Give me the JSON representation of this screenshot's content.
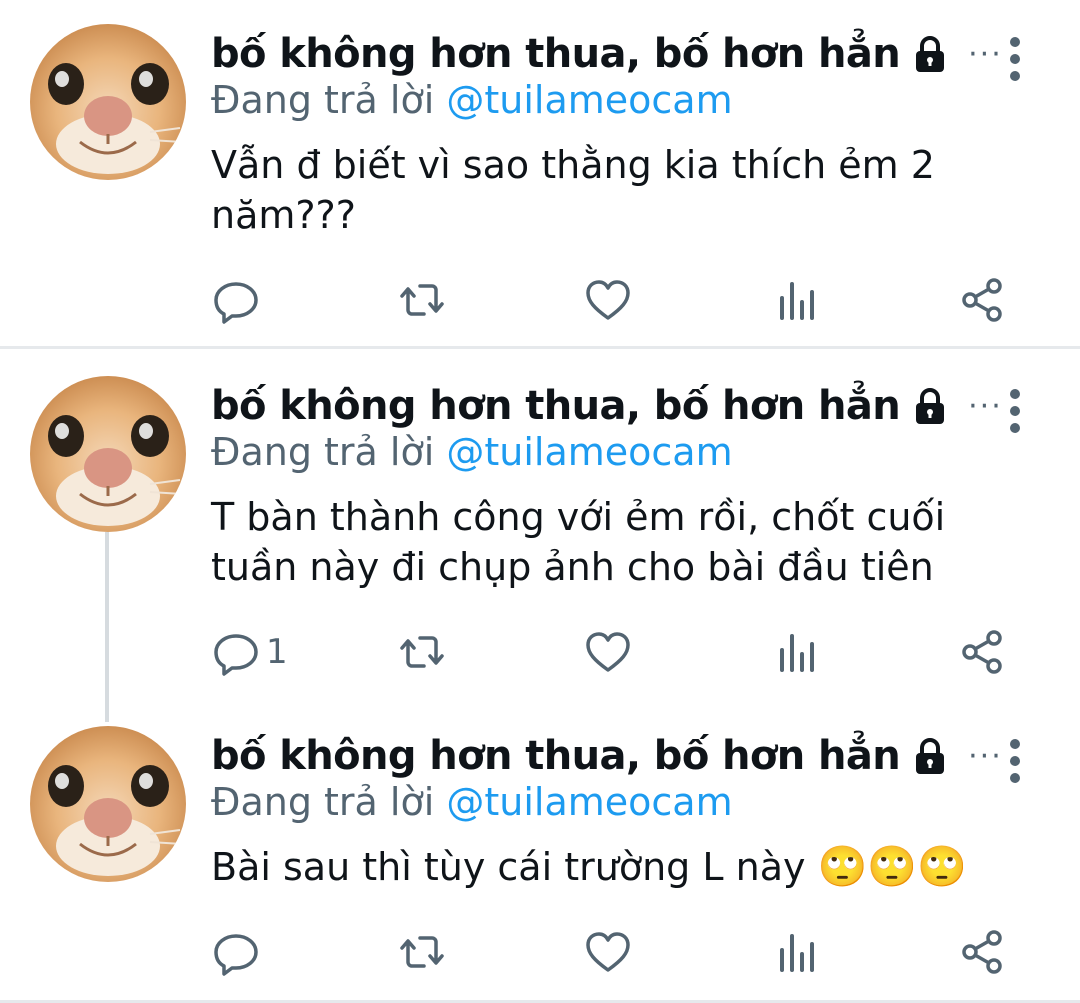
{
  "tweets": [
    {
      "display_name": "bố không hơn thua, bố hơn hẳn",
      "reply_label": "Đang trả lời",
      "reply_handle": "@tuilameocam",
      "text": "Vẫn đ biết vì sao thằng kia thích ẻm 2 năm???",
      "reply_count": "",
      "emoji": ""
    },
    {
      "display_name": "bố không hơn thua, bố hơn hẳn",
      "reply_label": "Đang trả lời",
      "reply_handle": "@tuilameocam",
      "text": "T bàn thành công với ẻm rồi, chốt cuối tuần này đi chụp ảnh cho bài đầu tiên",
      "reply_count": "1",
      "emoji": ""
    },
    {
      "display_name": "bố không hơn thua, bố hơn hẳn",
      "reply_label": "Đang trả lời",
      "reply_handle": "@tuilameocam",
      "text": "Bài sau thì tùy cái trường L này",
      "reply_count": "",
      "emoji": "🙄🙄🙄"
    }
  ],
  "icons": {
    "lock": "lock-icon",
    "more_horizontal": "more-horizontal-icon",
    "more_vertical": "more-vertical-icon",
    "reply": "reply-icon",
    "retweet": "retweet-icon",
    "like": "heart-icon",
    "views": "views-icon",
    "share": "share-icon"
  },
  "colors": {
    "link": "#1d9bf0",
    "secondary_text": "#536471",
    "primary_text": "#0f1419",
    "separator": "#e6e9ec",
    "thread_line": "#d6dbdf"
  }
}
